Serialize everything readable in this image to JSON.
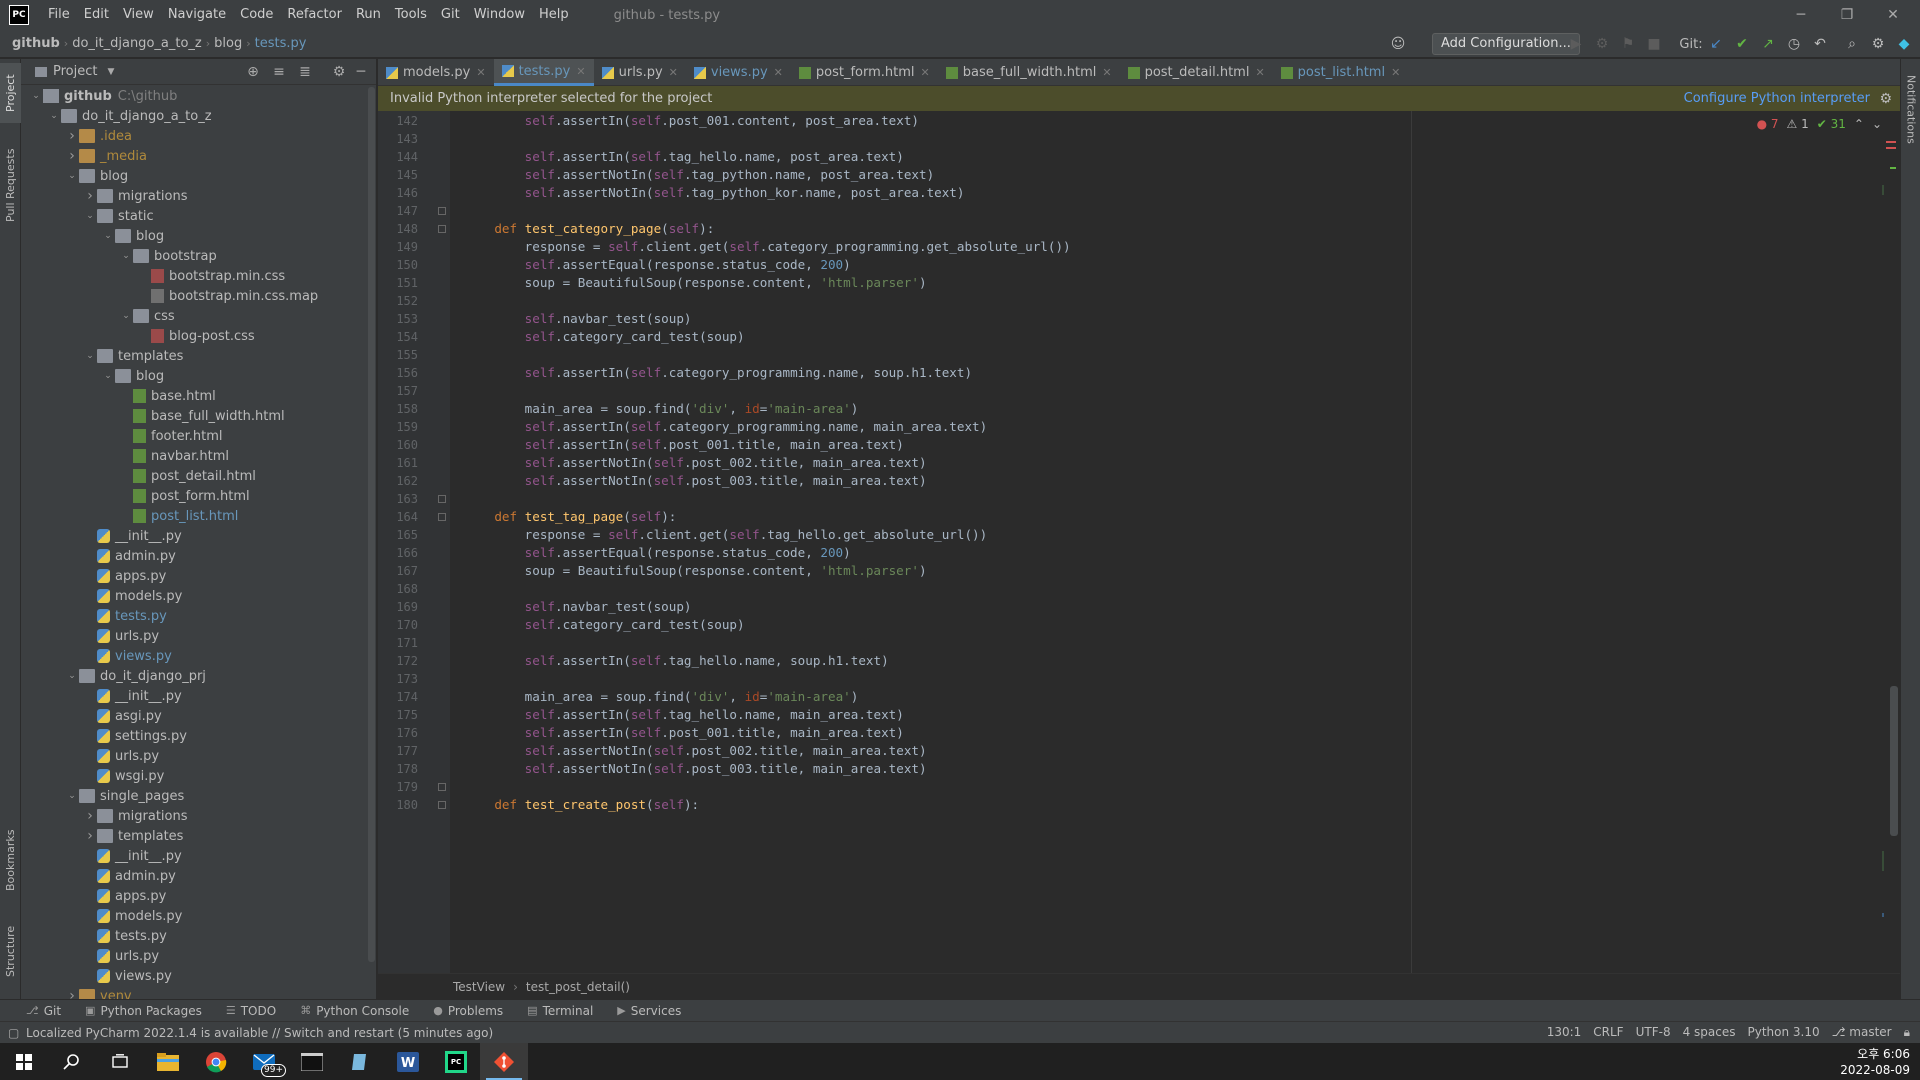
{
  "window": {
    "app_logo": "PC",
    "title": "github - tests.py",
    "menu": [
      "File",
      "Edit",
      "View",
      "Navigate",
      "Code",
      "Refactor",
      "Run",
      "Tools",
      "Git",
      "Window",
      "Help"
    ]
  },
  "navbar": {
    "crumbs": [
      "github",
      "do_it_django_a_to_z",
      "blog",
      "tests.py"
    ],
    "add_configuration": "Add Configuration...",
    "git_label": "Git:"
  },
  "left_strip": [
    "Project",
    "Pull Requests",
    "Bookmarks",
    "Structure"
  ],
  "right_strip": [
    "Notifications"
  ],
  "project_panel": {
    "title": "Project",
    "tree": [
      {
        "depth": 0,
        "arrow": "open",
        "icon": "root",
        "name": "github",
        "extra": "C:\\github",
        "style": "bold"
      },
      {
        "depth": 1,
        "arrow": "open",
        "icon": "folder",
        "name": "do_it_django_a_to_z"
      },
      {
        "depth": 2,
        "arrow": "closed",
        "icon": "folder-orange",
        "name": ".idea",
        "style": "orange"
      },
      {
        "depth": 2,
        "arrow": "closed",
        "icon": "folder-orange",
        "name": "_media",
        "style": "orange"
      },
      {
        "depth": 2,
        "arrow": "open",
        "icon": "folder",
        "name": "blog"
      },
      {
        "depth": 3,
        "arrow": "closed",
        "icon": "folder",
        "name": "migrations"
      },
      {
        "depth": 3,
        "arrow": "open",
        "icon": "folder",
        "name": "static"
      },
      {
        "depth": 4,
        "arrow": "open",
        "icon": "folder",
        "name": "blog"
      },
      {
        "depth": 5,
        "arrow": "open",
        "icon": "folder",
        "name": "bootstrap"
      },
      {
        "depth": 6,
        "arrow": "none",
        "icon": "css",
        "name": "bootstrap.min.css"
      },
      {
        "depth": 6,
        "arrow": "none",
        "icon": "map",
        "name": "bootstrap.min.css.map"
      },
      {
        "depth": 5,
        "arrow": "open",
        "icon": "folder",
        "name": "css"
      },
      {
        "depth": 6,
        "arrow": "none",
        "icon": "css",
        "name": "blog-post.css"
      },
      {
        "depth": 3,
        "arrow": "open",
        "icon": "folder",
        "name": "templates"
      },
      {
        "depth": 4,
        "arrow": "open",
        "icon": "folder",
        "name": "blog"
      },
      {
        "depth": 5,
        "arrow": "none",
        "icon": "html",
        "name": "base.html"
      },
      {
        "depth": 5,
        "arrow": "none",
        "icon": "html",
        "name": "base_full_width.html"
      },
      {
        "depth": 5,
        "arrow": "none",
        "icon": "html",
        "name": "footer.html"
      },
      {
        "depth": 5,
        "arrow": "none",
        "icon": "html",
        "name": "navbar.html"
      },
      {
        "depth": 5,
        "arrow": "none",
        "icon": "html",
        "name": "post_detail.html"
      },
      {
        "depth": 5,
        "arrow": "none",
        "icon": "html",
        "name": "post_form.html"
      },
      {
        "depth": 5,
        "arrow": "none",
        "icon": "html",
        "name": "post_list.html",
        "style": "blue"
      },
      {
        "depth": 3,
        "arrow": "none",
        "icon": "py",
        "name": "__init__.py"
      },
      {
        "depth": 3,
        "arrow": "none",
        "icon": "py",
        "name": "admin.py"
      },
      {
        "depth": 3,
        "arrow": "none",
        "icon": "py",
        "name": "apps.py"
      },
      {
        "depth": 3,
        "arrow": "none",
        "icon": "py",
        "name": "models.py"
      },
      {
        "depth": 3,
        "arrow": "none",
        "icon": "py",
        "name": "tests.py",
        "style": "blue"
      },
      {
        "depth": 3,
        "arrow": "none",
        "icon": "py",
        "name": "urls.py"
      },
      {
        "depth": 3,
        "arrow": "none",
        "icon": "py",
        "name": "views.py",
        "style": "blue"
      },
      {
        "depth": 2,
        "arrow": "open",
        "icon": "folder",
        "name": "do_it_django_prj"
      },
      {
        "depth": 3,
        "arrow": "none",
        "icon": "py",
        "name": "__init__.py"
      },
      {
        "depth": 3,
        "arrow": "none",
        "icon": "py",
        "name": "asgi.py"
      },
      {
        "depth": 3,
        "arrow": "none",
        "icon": "py",
        "name": "settings.py"
      },
      {
        "depth": 3,
        "arrow": "none",
        "icon": "py",
        "name": "urls.py"
      },
      {
        "depth": 3,
        "arrow": "none",
        "icon": "py",
        "name": "wsgi.py"
      },
      {
        "depth": 2,
        "arrow": "open",
        "icon": "folder",
        "name": "single_pages"
      },
      {
        "depth": 3,
        "arrow": "closed",
        "icon": "folder",
        "name": "migrations"
      },
      {
        "depth": 3,
        "arrow": "closed",
        "icon": "folder",
        "name": "templates"
      },
      {
        "depth": 3,
        "arrow": "none",
        "icon": "py",
        "name": "__init__.py"
      },
      {
        "depth": 3,
        "arrow": "none",
        "icon": "py",
        "name": "admin.py"
      },
      {
        "depth": 3,
        "arrow": "none",
        "icon": "py",
        "name": "apps.py"
      },
      {
        "depth": 3,
        "arrow": "none",
        "icon": "py",
        "name": "models.py"
      },
      {
        "depth": 3,
        "arrow": "none",
        "icon": "py",
        "name": "tests.py"
      },
      {
        "depth": 3,
        "arrow": "none",
        "icon": "py",
        "name": "urls.py"
      },
      {
        "depth": 3,
        "arrow": "none",
        "icon": "py",
        "name": "views.py"
      },
      {
        "depth": 2,
        "arrow": "closed",
        "icon": "folder-orange",
        "name": "venv",
        "style": "orange"
      }
    ]
  },
  "editor_tabs": [
    {
      "label": "models.py",
      "icon": "py"
    },
    {
      "label": "tests.py",
      "icon": "py",
      "active": true
    },
    {
      "label": "urls.py",
      "icon": "py"
    },
    {
      "label": "views.py",
      "icon": "py",
      "style": "blue"
    },
    {
      "label": "post_form.html",
      "icon": "html"
    },
    {
      "label": "base_full_width.html",
      "icon": "html"
    },
    {
      "label": "post_detail.html",
      "icon": "html"
    },
    {
      "label": "post_list.html",
      "icon": "html",
      "style": "blue"
    }
  ],
  "warning_bar": {
    "text": "Invalid Python interpreter selected for the project",
    "link": "Configure Python interpreter"
  },
  "inspection": {
    "errors": "7",
    "warnings": "1",
    "ok": "31"
  },
  "code": {
    "first_line": 142,
    "lines": [
      "        self.assertIn(self.post_001.content, post_area.text)",
      "",
      "        self.assertIn(self.tag_hello.name, post_area.text)",
      "        self.assertNotIn(self.tag_python.name, post_area.text)",
      "        self.assertNotIn(self.tag_python_kor.name, post_area.text)",
      "",
      "    def test_category_page(self):",
      "        response = self.client.get(self.category_programming.get_absolute_url())",
      "        self.assertEqual(response.status_code, 200)",
      "        soup = BeautifulSoup(response.content, 'html.parser')",
      "",
      "        self.navbar_test(soup)",
      "        self.category_card_test(soup)",
      "",
      "        self.assertIn(self.category_programming.name, soup.h1.text)",
      "",
      "        main_area = soup.find('div', id='main-area')",
      "        self.assertIn(self.category_programming.name, main_area.text)",
      "        self.assertIn(self.post_001.title, main_area.text)",
      "        self.assertNotIn(self.post_002.title, main_area.text)",
      "        self.assertNotIn(self.post_003.title, main_area.text)",
      "",
      "    def test_tag_page(self):",
      "        response = self.client.get(self.tag_hello.get_absolute_url())",
      "        self.assertEqual(response.status_code, 200)",
      "        soup = BeautifulSoup(response.content, 'html.parser')",
      "",
      "        self.navbar_test(soup)",
      "        self.category_card_test(soup)",
      "",
      "        self.assertIn(self.tag_hello.name, soup.h1.text)",
      "",
      "        main_area = soup.find('div', id='main-area')",
      "        self.assertIn(self.tag_hello.name, main_area.text)",
      "        self.assertIn(self.post_001.title, main_area.text)",
      "        self.assertNotIn(self.post_002.title, main_area.text)",
      "        self.assertNotIn(self.post_003.title, main_area.text)",
      "",
      "    def test_create_post(self):"
    ]
  },
  "code_breadcrumb": [
    "TestView",
    "test_post_detail()"
  ],
  "tool_tabs": [
    {
      "label": "Git",
      "icon": "git-icon"
    },
    {
      "label": "Python Packages",
      "icon": "packages-icon"
    },
    {
      "label": "TODO",
      "icon": "todo-icon"
    },
    {
      "label": "Python Console",
      "icon": "python-console-icon"
    },
    {
      "label": "Problems",
      "icon": "problems-icon"
    },
    {
      "label": "Terminal",
      "icon": "terminal-icon"
    },
    {
      "label": "Services",
      "icon": "services-icon"
    }
  ],
  "status": {
    "message": "Localized PyCharm 2022.1.4 is available // Switch and restart (5 minutes ago)",
    "position": "130:1",
    "line_sep": "CRLF",
    "encoding": "UTF-8",
    "indent": "4 spaces",
    "interpreter": "Python 3.10",
    "branch": "master"
  },
  "taskbar": {
    "mail_badge": "99+",
    "time": "오후 6:06",
    "date": "2022-08-09"
  },
  "colors": {
    "keyword": "#cc7832",
    "self": "#94558d",
    "function": "#ffc66d",
    "string": "#6a8759",
    "number": "#6897bb",
    "kwarg": "#aa4926",
    "plain": "#a9b7c6",
    "accent": "#4a88c7"
  }
}
